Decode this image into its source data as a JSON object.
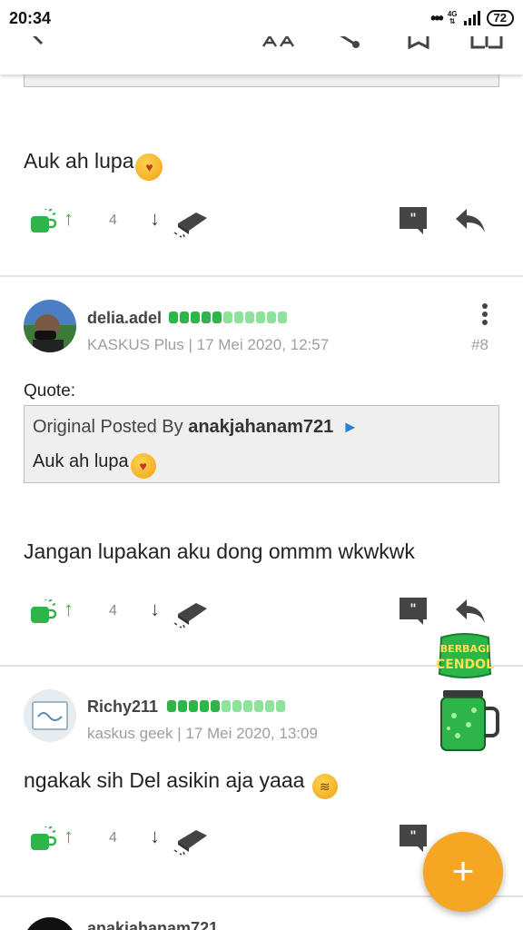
{
  "status_bar": {
    "time": "20:34",
    "network": "4G",
    "battery": "72"
  },
  "toolbar": {
    "icons": [
      "back-icon",
      "text-size-icon",
      "share-icon",
      "bookmark-icon",
      "book-icon"
    ]
  },
  "posts": [
    {
      "text": "Auk ah lupa",
      "actions": {
        "cendol_count": "4"
      }
    },
    {
      "username": "delia.adel",
      "meta": "KASKUS Plus | 17 Mei 2020, 12:57",
      "post_number": "#8",
      "quote_label": "Quote:",
      "quote_prefix": "Original Posted By",
      "quote_author": "anakjahanam721",
      "quote_text": "Auk ah lupa",
      "text": "Jangan lupakan aku dong ommm wkwkwk",
      "actions": {
        "cendol_count": "4"
      }
    },
    {
      "username": "Richy211",
      "meta": "kaskus geek | 17 Mei 2020, 13:09",
      "text": "ngakak sih Del asikin aja yaaa",
      "actions": {
        "cendol_count": "4"
      }
    },
    {
      "username": "anakjahanam721"
    }
  ],
  "badge": {
    "line1": "BERBAGI",
    "line2": "CENDOL"
  },
  "fab": {
    "label": "+"
  },
  "colors": {
    "accent_green": "#2db54a",
    "fab_orange": "#f5a623"
  }
}
